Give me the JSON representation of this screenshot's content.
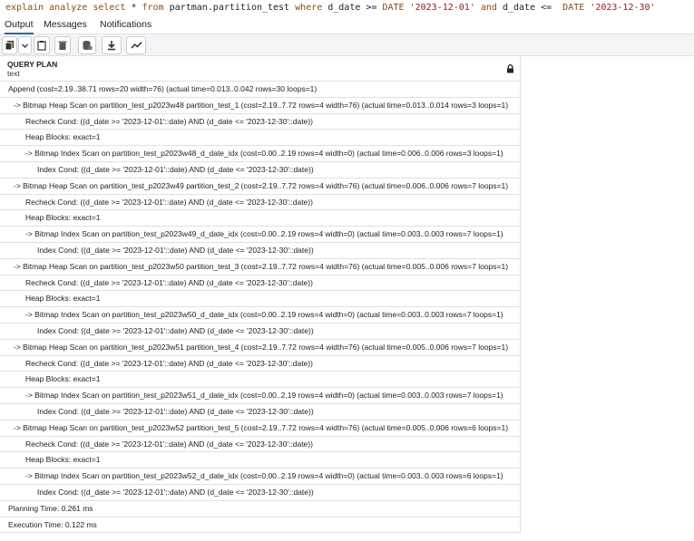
{
  "query": {
    "parts": [
      {
        "t": "explain analyze select",
        "c": "kw"
      },
      {
        "t": " * ",
        "c": ""
      },
      {
        "t": "from",
        "c": "kw"
      },
      {
        "t": " partman.partition_test ",
        "c": ""
      },
      {
        "t": "where",
        "c": "kw"
      },
      {
        "t": " d_date >= ",
        "c": ""
      },
      {
        "t": "DATE",
        "c": "kw"
      },
      {
        "t": " ",
        "c": ""
      },
      {
        "t": "'2023-12-01'",
        "c": "str"
      },
      {
        "t": " ",
        "c": ""
      },
      {
        "t": "and",
        "c": "kw"
      },
      {
        "t": " d_date <=  ",
        "c": ""
      },
      {
        "t": "DATE",
        "c": "kw"
      },
      {
        "t": " ",
        "c": ""
      },
      {
        "t": "'2023-12-30'",
        "c": "str"
      }
    ]
  },
  "tabs": [
    {
      "label": "Output",
      "active": true
    },
    {
      "label": "Messages",
      "active": false
    },
    {
      "label": "Notifications",
      "active": false
    }
  ],
  "toolbar": {
    "buttons": [
      {
        "name": "copy-button",
        "icon": "copy-icon"
      },
      {
        "name": "copy-options-dropdown",
        "icon": "chevron-down-icon"
      },
      {
        "name": "paste-button",
        "icon": "clipboard-icon"
      },
      {
        "name": "delete-button",
        "icon": "trash-icon"
      },
      {
        "name": "save-data-button",
        "icon": "database-save-icon"
      },
      {
        "name": "download-button",
        "icon": "download-icon"
      },
      {
        "name": "graph-button",
        "icon": "line-chart-icon"
      }
    ]
  },
  "grid": {
    "column_name": "QUERY PLAN",
    "column_type": "text",
    "rows": [
      {
        "indent": 0,
        "text": "Append  (cost=2.19..38.71 rows=20 width=76) (actual time=0.013..0.042 rows=30 loops=1)"
      },
      {
        "indent": 1,
        "text": "->  Bitmap Heap Scan on partition_test_p2023w48 partition_test_1  (cost=2.19..7.72 rows=4 width=76) (actual time=0.013..0.014 rows=3 loops=1)"
      },
      {
        "indent": 2,
        "text": "Recheck Cond: ((d_date >= '2023-12-01'::date) AND (d_date <= '2023-12-30'::date))"
      },
      {
        "indent": 2,
        "text": "Heap Blocks: exact=1"
      },
      {
        "indent": 2,
        "text": "->  Bitmap Index Scan on partition_test_p2023w48_d_date_idx  (cost=0.00..2.19 rows=4 width=0) (actual time=0.006..0.006 rows=3 loops=1)"
      },
      {
        "indent": 3,
        "text": "Index Cond: ((d_date >= '2023-12-01'::date) AND (d_date <= '2023-12-30'::date))"
      },
      {
        "indent": 1,
        "text": "->  Bitmap Heap Scan on partition_test_p2023w49 partition_test_2  (cost=2.19..7.72 rows=4 width=76) (actual time=0.006..0.006 rows=7 loops=1)"
      },
      {
        "indent": 2,
        "text": "Recheck Cond: ((d_date >= '2023-12-01'::date) AND (d_date <= '2023-12-30'::date))"
      },
      {
        "indent": 2,
        "text": "Heap Blocks: exact=1"
      },
      {
        "indent": 2,
        "text": "->  Bitmap Index Scan on partition_test_p2023w49_d_date_idx  (cost=0.00..2.19 rows=4 width=0) (actual time=0.003..0.003 rows=7 loops=1)"
      },
      {
        "indent": 3,
        "text": "Index Cond: ((d_date >= '2023-12-01'::date) AND (d_date <= '2023-12-30'::date))"
      },
      {
        "indent": 1,
        "text": "->  Bitmap Heap Scan on partition_test_p2023w50 partition_test_3  (cost=2.19..7.72 rows=4 width=76) (actual time=0.005..0.006 rows=7 loops=1)"
      },
      {
        "indent": 2,
        "text": "Recheck Cond: ((d_date >= '2023-12-01'::date) AND (d_date <= '2023-12-30'::date))"
      },
      {
        "indent": 2,
        "text": "Heap Blocks: exact=1"
      },
      {
        "indent": 2,
        "text": "->  Bitmap Index Scan on partition_test_p2023w50_d_date_idx  (cost=0.00..2.19 rows=4 width=0) (actual time=0.003..0.003 rows=7 loops=1)"
      },
      {
        "indent": 3,
        "text": "Index Cond: ((d_date >= '2023-12-01'::date) AND (d_date <= '2023-12-30'::date))"
      },
      {
        "indent": 1,
        "text": "->  Bitmap Heap Scan on partition_test_p2023w51 partition_test_4  (cost=2.19..7.72 rows=4 width=76) (actual time=0.005..0.006 rows=7 loops=1)"
      },
      {
        "indent": 2,
        "text": "Recheck Cond: ((d_date >= '2023-12-01'::date) AND (d_date <= '2023-12-30'::date))"
      },
      {
        "indent": 2,
        "text": "Heap Blocks: exact=1"
      },
      {
        "indent": 2,
        "text": "->  Bitmap Index Scan on partition_test_p2023w51_d_date_idx  (cost=0.00..2.19 rows=4 width=0) (actual time=0.003..0.003 rows=7 loops=1)"
      },
      {
        "indent": 3,
        "text": "Index Cond: ((d_date >= '2023-12-01'::date) AND (d_date <= '2023-12-30'::date))"
      },
      {
        "indent": 1,
        "text": "->  Bitmap Heap Scan on partition_test_p2023w52 partition_test_5  (cost=2.19..7.72 rows=4 width=76) (actual time=0.005..0.006 rows=6 loops=1)"
      },
      {
        "indent": 2,
        "text": "Recheck Cond: ((d_date >= '2023-12-01'::date) AND (d_date <= '2023-12-30'::date))"
      },
      {
        "indent": 2,
        "text": "Heap Blocks: exact=1"
      },
      {
        "indent": 2,
        "text": "->  Bitmap Index Scan on partition_test_p2023w52_d_date_idx  (cost=0.00..2.19 rows=4 width=0) (actual time=0.003..0.003 rows=6 loops=1)"
      },
      {
        "indent": 3,
        "text": "Index Cond: ((d_date >= '2023-12-01'::date) AND (d_date <= '2023-12-30'::date))"
      },
      {
        "indent": 0,
        "text": "Planning Time: 0.261 ms"
      },
      {
        "indent": 0,
        "text": "Execution Time: 0.122 ms"
      }
    ]
  }
}
